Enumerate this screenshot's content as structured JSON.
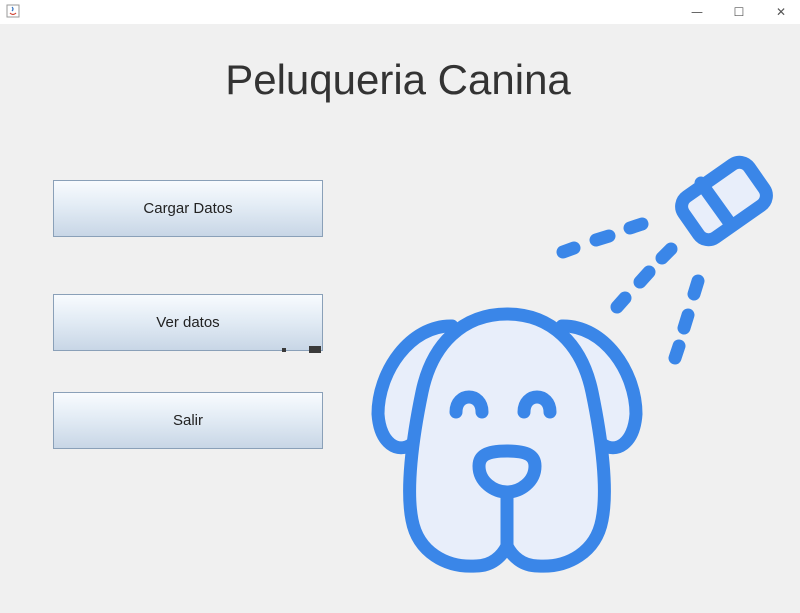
{
  "window": {
    "controls": {
      "minimize": "—",
      "maximize": "☐",
      "close": "✕"
    }
  },
  "header": {
    "title": "Peluqueria Canina"
  },
  "buttons": {
    "load": "Cargar Datos",
    "view": "Ver datos",
    "exit": "Salir"
  },
  "illustration": {
    "icon": "dog-grooming-shower-icon",
    "stroke_color": "#3a86e8",
    "fill_color": "#e8eefa"
  },
  "colors": {
    "background": "#f0f0f0",
    "title_text": "#333333",
    "button_border": "#8aa0b8"
  }
}
